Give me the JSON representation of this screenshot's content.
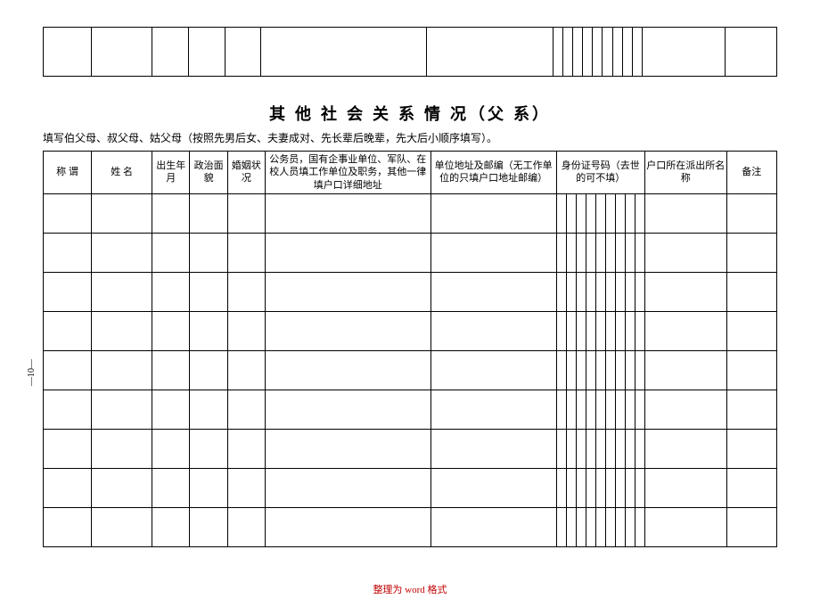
{
  "page_marker": "—10—",
  "section": {
    "title": "其 他 社 会 关 系 情 况（父 系）",
    "subtitle": "填写伯父母、叔父母、姑父母（按照先男后女、夫妻成对、先长辈后晚辈，先大后小顺序填写）。"
  },
  "headers": {
    "col1": "称  谓",
    "col2": "姓  名",
    "col3": "出生年月",
    "col4": "政治面貌",
    "col5": "婚姻状况",
    "col6": "公务员，国有企事业单位、军队、在校人员填工作单位及职务，其他一律填户口详细地址",
    "col7": "单位地址及邮编（无工作单位的只填户口地址邮编）",
    "col8": "身份证号码（去世的可不填）",
    "col9": "户口所在派出所名称",
    "col10": "备注"
  },
  "footer": "整理为 word 格式"
}
